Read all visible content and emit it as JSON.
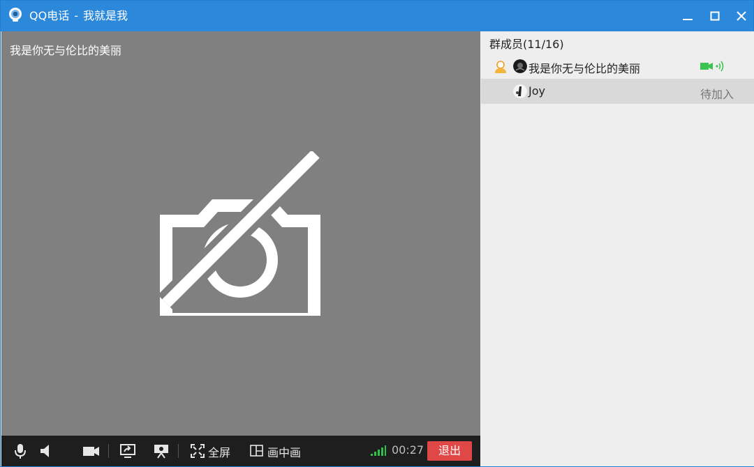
{
  "window": {
    "app_name": "QQ电话",
    "separator": "-",
    "call_name": "我就是我",
    "accent_color": "#2b88db"
  },
  "video": {
    "participant_name": "我是你无与伦比的美丽",
    "camera_off_icon": "camera-off-icon"
  },
  "toolbar": {
    "fullscreen_label": "全屏",
    "pip_label": "画中画",
    "call_time": "00:27",
    "exit_label": "退出",
    "exit_color": "#e04848"
  },
  "members": {
    "title": "群成员(11/16)",
    "items": [
      {
        "name": "我是你无与伦比的美丽",
        "role": "host",
        "status": "speaking-video"
      },
      {
        "name": "Joy",
        "status_text": "待加入"
      }
    ]
  }
}
